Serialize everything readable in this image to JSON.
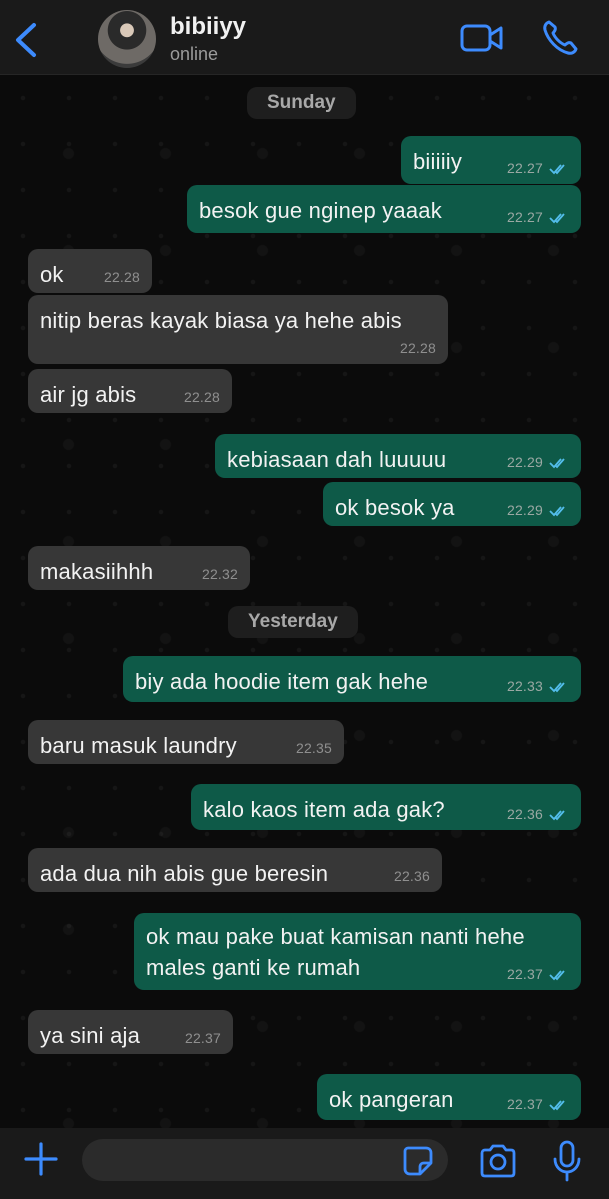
{
  "header": {
    "contact_name": "bibiiyy",
    "status": "online",
    "back_icon": "chevron-left-icon",
    "video_icon": "video-camera-icon",
    "call_icon": "phone-icon"
  },
  "colors": {
    "accent": "#3d8bfd",
    "incoming_bubble": "#373737",
    "outgoing_bubble": "#0e5a48",
    "read_tick": "#53bdeb"
  },
  "days": {
    "sunday": "Sunday",
    "yesterday": "Yesterday"
  },
  "messages": [
    {
      "dir": "out",
      "text": "biiiiiy",
      "time": "22.27",
      "read": true
    },
    {
      "dir": "out",
      "text": "besok gue nginep yaaak",
      "time": "22.27",
      "read": true
    },
    {
      "dir": "in",
      "text": "ok",
      "time": "22.28"
    },
    {
      "dir": "in",
      "text": "nitip beras kayak biasa ya hehe abis",
      "time": "22.28"
    },
    {
      "dir": "in",
      "text": "air jg abis",
      "time": "22.28"
    },
    {
      "dir": "out",
      "text": "kebiasaan dah luuuuu",
      "time": "22.29",
      "read": true
    },
    {
      "dir": "out",
      "text": "ok besok ya",
      "time": "22.29",
      "read": true
    },
    {
      "dir": "in",
      "text": "makasiihhh",
      "time": "22.32"
    },
    {
      "dir": "out",
      "text": "biy ada hoodie item gak hehe",
      "time": "22.33",
      "read": true
    },
    {
      "dir": "in",
      "text": "baru masuk laundry",
      "time": "22.35"
    },
    {
      "dir": "out",
      "text": "kalo kaos item ada gak?",
      "time": "22.36",
      "read": true
    },
    {
      "dir": "in",
      "text": "ada dua nih abis gue beresin",
      "time": "22.36"
    },
    {
      "dir": "out",
      "line1": "ok mau pake buat kamisan nanti hehe",
      "line2": "males ganti ke rumah",
      "time": "22.37",
      "read": true
    },
    {
      "dir": "in",
      "text": "ya sini aja",
      "time": "22.37"
    },
    {
      "dir": "out",
      "text": "ok pangeran",
      "time": "22.37",
      "read": true
    }
  ],
  "composer": {
    "input_value": "",
    "plus_icon": "plus-icon",
    "sticker_icon": "sticker-icon",
    "camera_icon": "camera-icon",
    "mic_icon": "microphone-icon"
  }
}
